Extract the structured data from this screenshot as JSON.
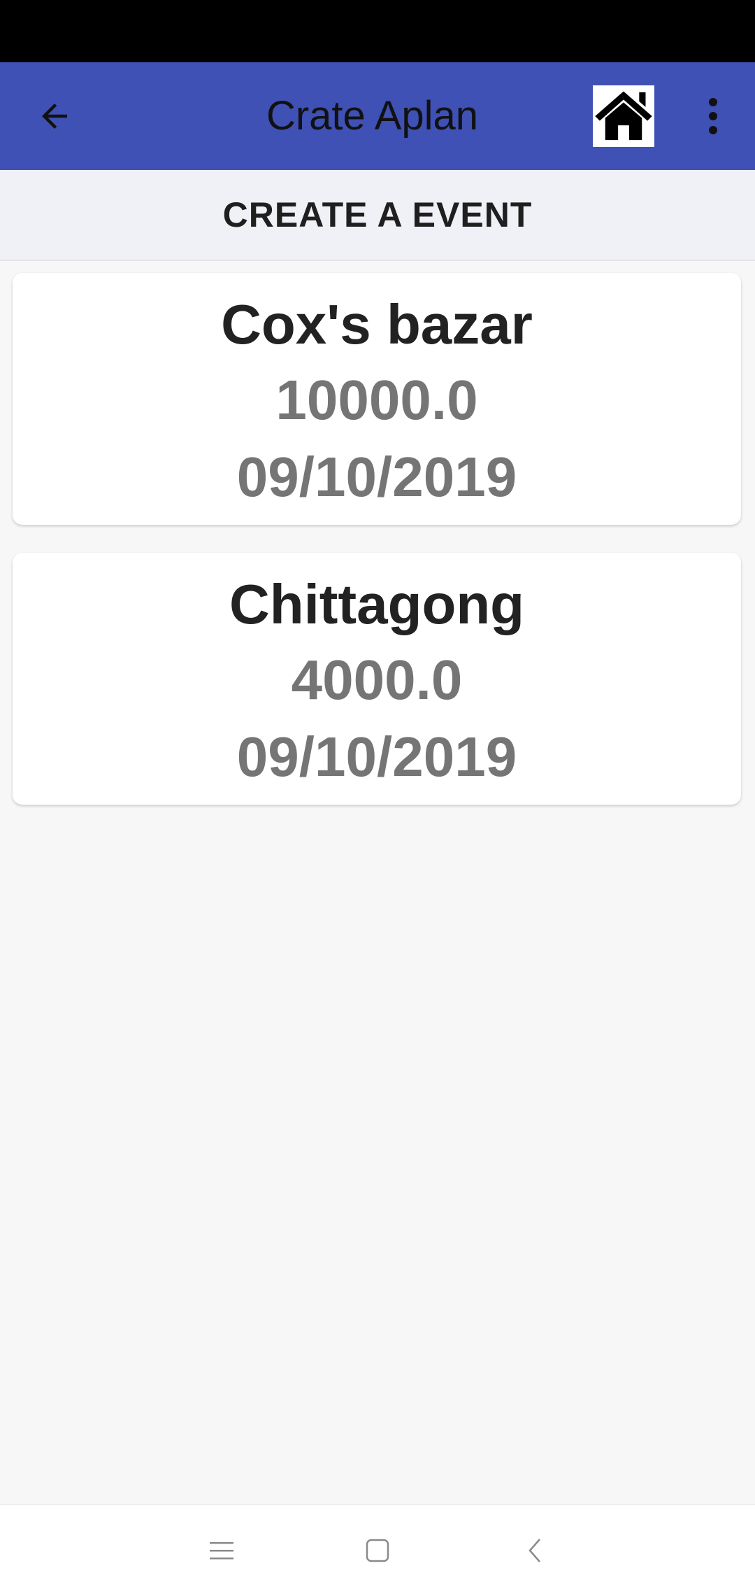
{
  "app_bar": {
    "title": "Crate Aplan",
    "background": "#3f51b5",
    "back_icon": "arrow-left-icon",
    "home_icon": "home-icon",
    "more_icon": "more-vert-icon"
  },
  "subheader": {
    "label": "CREATE A EVENT"
  },
  "events": [
    {
      "place": "Cox's bazar",
      "amount": "10000.0",
      "date": "09/10/2019"
    },
    {
      "place": "Chittagong",
      "amount": "4000.0",
      "date": "09/10/2019"
    }
  ],
  "nav_bar": {
    "menu_icon": "menu-icon",
    "home_icon": "square-home-icon",
    "back_icon": "chevron-left-icon"
  }
}
